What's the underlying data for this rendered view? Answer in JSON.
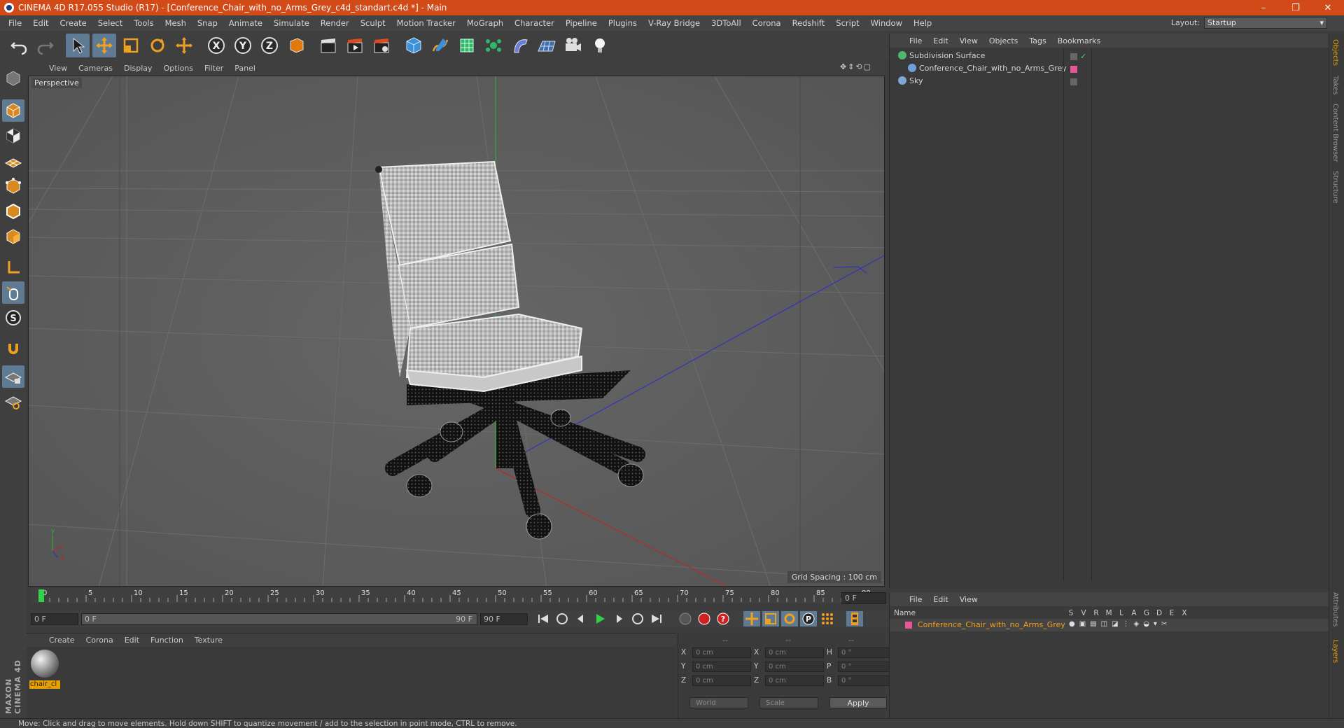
{
  "window": {
    "title": "CINEMA 4D R17.055 Studio (R17) - [Conference_Chair_with_no_Arms_Grey_c4d_standart.c4d *] - Main",
    "controls": [
      "–",
      "❐",
      "✕"
    ]
  },
  "menubar": {
    "items": [
      "File",
      "Edit",
      "Create",
      "Select",
      "Tools",
      "Mesh",
      "Snap",
      "Animate",
      "Simulate",
      "Render",
      "Sculpt",
      "Motion Tracker",
      "MoGraph",
      "Character",
      "Pipeline",
      "Plugins",
      "V-Ray Bridge",
      "3DToAll",
      "Corona",
      "Redshift",
      "Script",
      "Window",
      "Help"
    ],
    "layout_label": "Layout:",
    "layout_value": "Startup"
  },
  "viewport": {
    "menu": [
      "View",
      "Cameras",
      "Display",
      "Options",
      "Filter",
      "Panel"
    ],
    "label": "Perspective",
    "grid_spacing": "Grid Spacing : 100 cm",
    "nav_icons": "✥⇕⟲▢"
  },
  "timeline": {
    "ticks": [
      "0",
      "5",
      "10",
      "15",
      "20",
      "25",
      "30",
      "35",
      "40",
      "45",
      "50",
      "55",
      "60",
      "65",
      "70",
      "75",
      "80",
      "85",
      "90"
    ],
    "current_frame_field": "0 F",
    "start_field": "0 F",
    "range_start": "0 F",
    "range_end": "90 F",
    "end_field": "90 F"
  },
  "material_panel": {
    "menu": [
      "Create",
      "Corona",
      "Edit",
      "Function",
      "Texture"
    ],
    "material_name": "chair_cl"
  },
  "coordinates": {
    "headers": [
      "--",
      "--",
      "--"
    ],
    "rows": [
      {
        "l1": "X",
        "v1": "0 cm",
        "l2": "X",
        "v2": "0 cm",
        "l3": "H",
        "v3": "0 °"
      },
      {
        "l1": "Y",
        "v1": "0 cm",
        "l2": "Y",
        "v2": "0 cm",
        "l3": "P",
        "v3": "0 °"
      },
      {
        "l1": "Z",
        "v1": "0 cm",
        "l2": "Z",
        "v2": "0 cm",
        "l3": "B",
        "v3": "0 °"
      }
    ],
    "world_dropdown": "World",
    "scale_dropdown": "Scale",
    "apply_label": "Apply"
  },
  "object_manager": {
    "menu": [
      "File",
      "Edit",
      "View",
      "Objects",
      "Tags",
      "Bookmarks"
    ],
    "objects": [
      {
        "name": "Subdivision Surface",
        "indent": 0,
        "icon_color": "#4fb86a"
      },
      {
        "name": "Conference_Chair_with_no_Arms_Grey",
        "indent": 1,
        "icon_color": "#6f9fd8"
      },
      {
        "name": "Sky",
        "indent": 0,
        "icon_color": "#7fa6d6"
      }
    ],
    "tag_color": "#e8569a"
  },
  "layer_manager": {
    "menu": [
      "File",
      "Edit",
      "View"
    ],
    "header_name": "Name",
    "header_cols": [
      "S",
      "V",
      "R",
      "M",
      "L",
      "A",
      "G",
      "D",
      "E",
      "X"
    ],
    "layer_name": "Conference_Chair_with_no_Arms_Grey",
    "layer_color": "#e8569a"
  },
  "right_tabs": [
    "Objects",
    "Takes",
    "Content Browser",
    "Structure"
  ],
  "right_tabs_bottom": [
    "Attributes",
    "Layers"
  ],
  "maxon_logo": "MAXON CINEMA 4D",
  "status": "Move: Click and drag to move elements. Hold down SHIFT to quantize movement / add to the selection in point mode, CTRL to remove.",
  "colors": {
    "titlebar": "#d24a17",
    "accent_orange": "#e8a000",
    "active_tool": "#5f7a93",
    "axis_green": "#2fb52f",
    "axis_blue": "#2a2ad0",
    "axis_red": "#c82020"
  }
}
